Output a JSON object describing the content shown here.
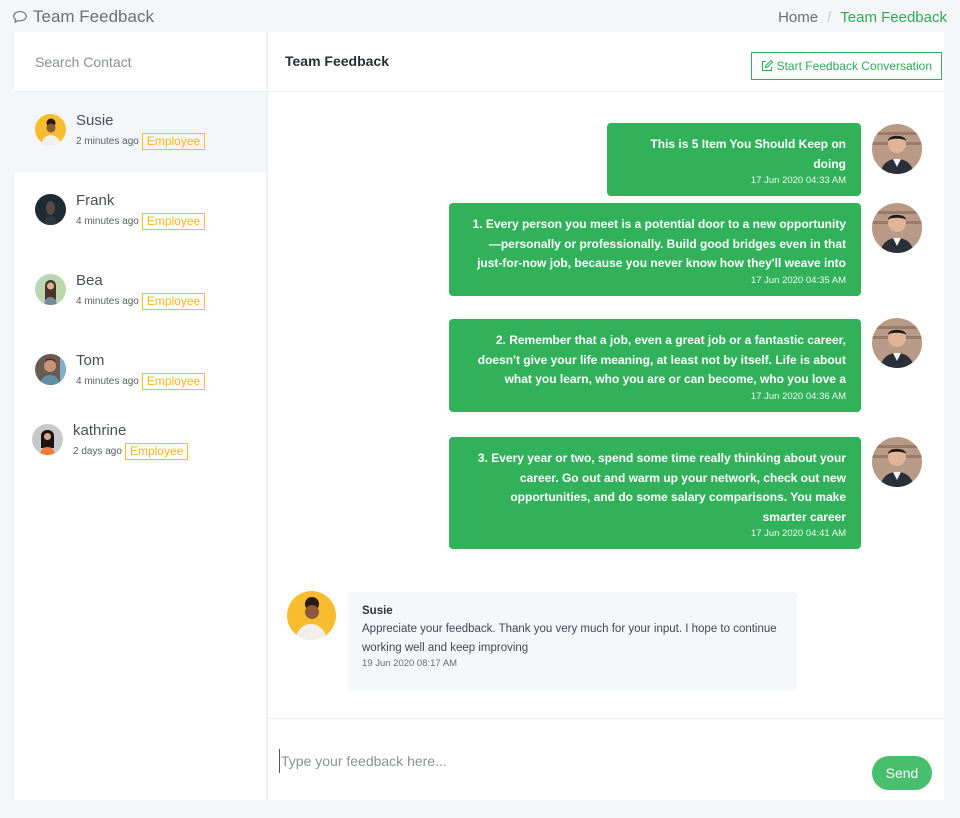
{
  "header": {
    "title": "Team Feedback",
    "title_icon": "chat-bubble-icon",
    "breadcrumb": {
      "home": "Home",
      "separator": "/",
      "current": "Team Feedback"
    }
  },
  "colors": {
    "accent": "#30b15a",
    "badge": "#f2b618",
    "background": "#f5f6f8"
  },
  "sidebar": {
    "search_placeholder": "Search Contact",
    "contacts": [
      {
        "name": "Susie",
        "time": "2 minutes ago",
        "role": "Employee",
        "active": true
      },
      {
        "name": "Frank",
        "time": "4 minutes ago",
        "role": "Employee",
        "active": false
      },
      {
        "name": "Bea",
        "time": "4 minutes ago",
        "role": "Employee",
        "active": false
      },
      {
        "name": "Tom",
        "time": "4 minutes ago",
        "role": "Employee",
        "active": false
      },
      {
        "name": "kathrine",
        "time": "2 days ago",
        "role": "Employee",
        "active": false
      }
    ]
  },
  "main": {
    "title": "Team Feedback",
    "start_button": {
      "label": "Start Feedback Conversation",
      "icon": "edit-icon"
    },
    "outgoing_messages": [
      {
        "text": "This is 5 Item You Should Keep on doing",
        "time": "17 Jun 2020 04:33 AM"
      },
      {
        "text": "1. Every person you meet is a potential door to a new opportunity—personally or professionally. Build good bridges even in that just-for-now job, because you never know how they'll weave into",
        "time": "17 Jun 2020 04:35 AM"
      },
      {
        "text": "2. Remember that a job, even a great job or a fantastic career, doesn't give your life meaning, at least not by itself. Life is about what you learn, who you are or can become, who you love a",
        "time": "17 Jun 2020 04:36 AM"
      },
      {
        "text": "3. Every year or two, spend some time really thinking about your career. Go out and warm up your network, check out new opportunities, and do some salary comparisons. You make smarter career",
        "time": "17 Jun 2020 04:41 AM"
      }
    ],
    "incoming_message": {
      "sender": "Susie",
      "text": "Appreciate your feedback. Thank you very much for your input. I hope to continue working well and keep improving",
      "time": "19 Jun 2020 08:17 AM"
    },
    "composer": {
      "placeholder": "Type your feedback here...",
      "value": "",
      "send_label": "Send"
    }
  }
}
